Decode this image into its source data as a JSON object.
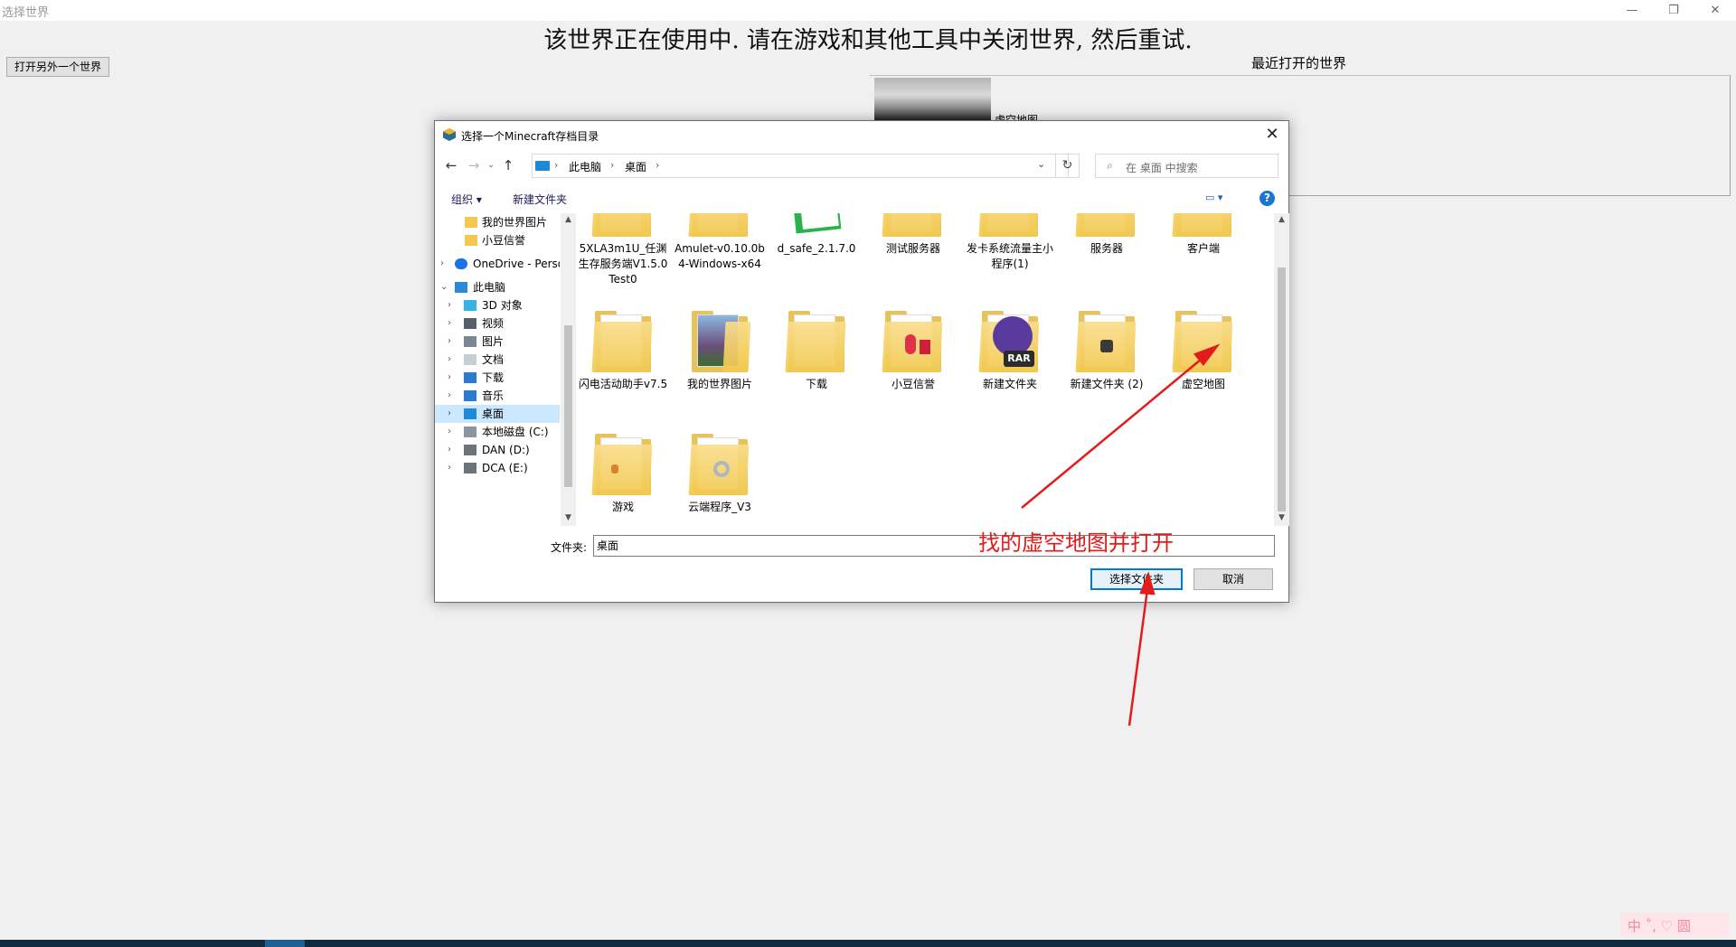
{
  "app": {
    "title": "选择世界",
    "controls": {
      "minimize": "—",
      "restore": "❐",
      "close": "✕"
    },
    "banner": "该世界正在使用中.  请在游戏和其他工具中关闭世界, 然后重试.",
    "open_other_button": "打开另外一个世界",
    "recent_title": "最近打开的世界",
    "recent_worlds": [
      {
        "name": "虚空地图"
      }
    ]
  },
  "dialog": {
    "title": "选择一个Minecraft存档目录",
    "close": "✕",
    "nav": {
      "back": "←",
      "forward": "→",
      "recent": "⌄",
      "up": "↑",
      "refresh": "↻",
      "dropdown": "⌄"
    },
    "breadcrumbs": [
      "此电脑",
      "桌面"
    ],
    "breadcrumb_sep": "›",
    "search_placeholder": "在 桌面 中搜索",
    "toolbar": {
      "organize": "组织 ▾",
      "new_folder": "新建文件夹",
      "view": "▭ ▾",
      "help": "?"
    },
    "tree": [
      {
        "label": "我的世界图片",
        "icon": "folder-icon"
      },
      {
        "label": "小豆信誉",
        "icon": "folder-icon"
      },
      {
        "label": "OneDrive - Perso",
        "icon": "onedrive-icon"
      },
      {
        "label": "此电脑",
        "icon": "computer-icon"
      },
      {
        "label": "3D 对象",
        "icon": "3d-objects-icon"
      },
      {
        "label": "视频",
        "icon": "video-icon"
      },
      {
        "label": "图片",
        "icon": "pictures-icon"
      },
      {
        "label": "文档",
        "icon": "documents-icon"
      },
      {
        "label": "下载",
        "icon": "download-icon"
      },
      {
        "label": "音乐",
        "icon": "music-icon"
      },
      {
        "label": "桌面",
        "icon": "desktop-icon"
      },
      {
        "label": "本地磁盘 (C:)",
        "icon": "drive-icon"
      },
      {
        "label": "DAN (D:)",
        "icon": "drive-icon"
      },
      {
        "label": "DCA (E:)",
        "icon": "drive-icon"
      }
    ],
    "files": [
      {
        "label": "5XLA3m1U_任渊生存服务端V1.5.0 Test0"
      },
      {
        "label": "Amulet-v0.10.0b4-Windows-x64"
      },
      {
        "label": "d_safe_2.1.7.0"
      },
      {
        "label": "测试服务器"
      },
      {
        "label": "发卡系统流量主小程序(1)"
      },
      {
        "label": "服务器"
      },
      {
        "label": "客户端"
      },
      {
        "label": "闪电活动助手v7.5"
      },
      {
        "label": "我的世界图片"
      },
      {
        "label": "下载"
      },
      {
        "label": "小豆信誉"
      },
      {
        "label": "新建文件夹"
      },
      {
        "label": "新建文件夹 (2)"
      },
      {
        "label": "虚空地图"
      },
      {
        "label": "游戏"
      },
      {
        "label": "云端程序_V3"
      }
    ],
    "rar_badge": "RAR",
    "folder_label": "文件夹:",
    "folder_value": "桌面",
    "hint": "找的虚空地图并打开",
    "select_button": "选择文件夹",
    "cancel_button": "取消"
  },
  "tray": {
    "ime": "中 ˚, ♡ 圆"
  },
  "colors": {
    "accent": "#0078d7",
    "annotation": "#e31b1b",
    "folder": "#f2c94e"
  }
}
